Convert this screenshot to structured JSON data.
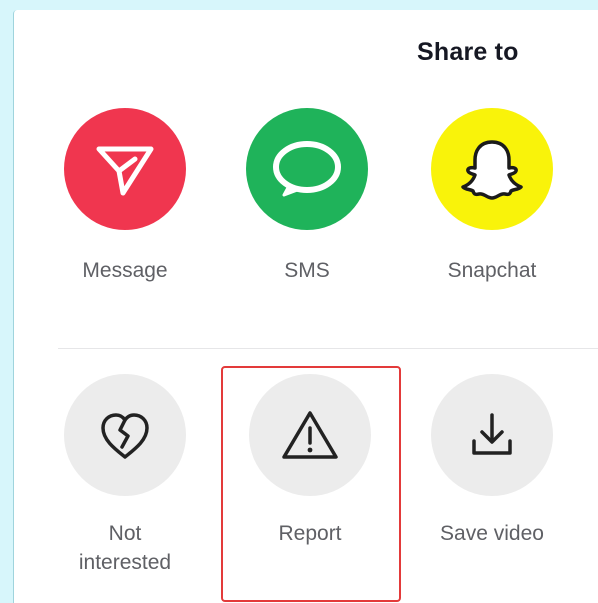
{
  "header": {
    "title": "Share to"
  },
  "share_targets": [
    {
      "label": "Message",
      "icon": "paper-plane-icon",
      "color": "#f0364f"
    },
    {
      "label": "SMS",
      "icon": "chat-bubble-icon",
      "color": "#1fb35a"
    },
    {
      "label": "Snapchat",
      "icon": "snapchat-ghost-icon",
      "color": "#f9f30a"
    }
  ],
  "actions": [
    {
      "label_line1": "Not",
      "label_line2": "interested",
      "icon": "broken-heart-icon"
    },
    {
      "label": "Report",
      "icon": "warning-triangle-icon",
      "highlighted": true,
      "highlight_color": "#e33a3a"
    },
    {
      "label": "Save video",
      "icon": "download-icon"
    }
  ]
}
